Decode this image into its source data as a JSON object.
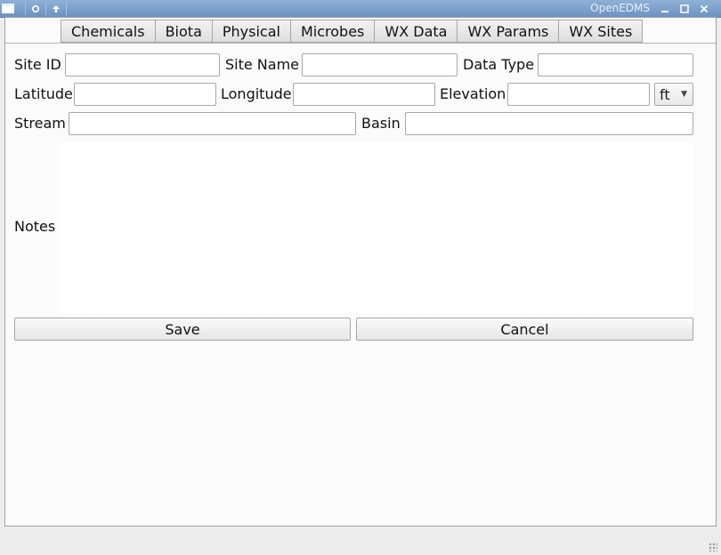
{
  "window": {
    "title": "OpenEDMS"
  },
  "titlebar_icons": [
    "window-menu-icon",
    "pin-icon",
    "keep-above-icon",
    "minimize-icon",
    "maximize-icon",
    "close-icon"
  ],
  "tabs": [
    {
      "label": "Chemicals"
    },
    {
      "label": "Biota"
    },
    {
      "label": "Physical"
    },
    {
      "label": "Microbes"
    },
    {
      "label": "WX Data"
    },
    {
      "label": "WX Params"
    },
    {
      "label": "WX Sites"
    }
  ],
  "form": {
    "site_id": {
      "label": "Site ID",
      "value": ""
    },
    "site_name": {
      "label": "Site Name",
      "value": ""
    },
    "data_type": {
      "label": "Data Type",
      "value": ""
    },
    "latitude": {
      "label": "Latitude",
      "value": ""
    },
    "longitude": {
      "label": "Longitude",
      "value": ""
    },
    "elevation": {
      "label": "Elevation",
      "value": "",
      "unit": "ft"
    },
    "stream": {
      "label": "Stream",
      "value": ""
    },
    "basin": {
      "label": "Basin",
      "value": ""
    },
    "notes": {
      "label": "Notes",
      "value": ""
    }
  },
  "buttons": {
    "save": "Save",
    "cancel": "Cancel"
  }
}
